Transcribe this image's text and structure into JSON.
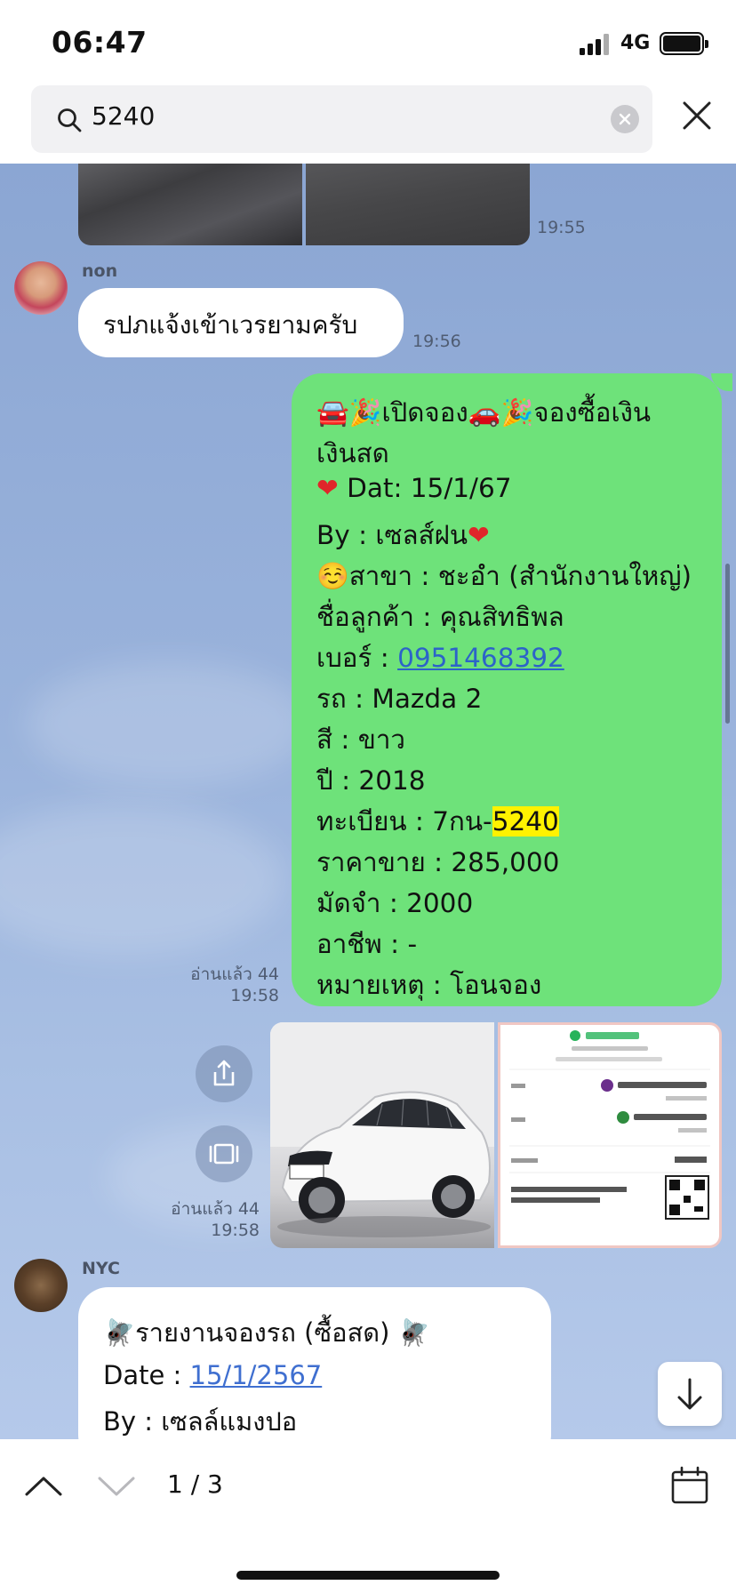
{
  "status_bar": {
    "time": "06:47",
    "network": "4G"
  },
  "search": {
    "query": "5240"
  },
  "messages": {
    "photo_time": "19:55",
    "msg1": {
      "sender": "non",
      "text": "รปภแจ้งเข้าเวรยามครับ",
      "time": "19:56"
    },
    "msg2": {
      "read": "อ่านแล้ว 44",
      "time": "19:58",
      "lines": {
        "l1": "🚘🎉เปิดจอง🚗🎉จองซื้อเงิน",
        "l2": "เงินสด",
        "l3_label": "Dat: 15/1/67",
        "l4_label": "By : เซลส์ฝน",
        "l5": "☺️สาขา : ชะอำ (สำนักงานใหญ่)",
        "l6": "ชื่อลูกค้า : คุณสิทธิพล",
        "l7_prefix": "เบอร์ : ",
        "l7_phone": "0951468392",
        "l8": "รถ : Mazda 2",
        "l9": "สี : ขาว",
        "l10": "ปี : 2018",
        "l11_prefix": "ทะเบียน : 7กน-",
        "l11_match": "5240",
        "l12": "ราคาขาย : 285,000",
        "l13": "มัดจำ : 2000",
        "l14": "อาชีพ : -",
        "l15": "หมายเหตุ : โอนจอง"
      }
    },
    "msg3": {
      "read": "อ่านแล้ว 44",
      "time": "19:58"
    },
    "msg4": {
      "sender": "NYC",
      "title": "🪰รายงานจองรถ (ซื้อสด) 🪰",
      "date_prefix": "Date : ",
      "date_link": "15/1/2567",
      "by": "By : เซลล์แมงปอ"
    }
  },
  "bottom": {
    "counter": "1 / 3"
  },
  "colors": {
    "chat_bg": "#8ba6d3",
    "sent_bubble": "#6ee27a",
    "received_bubble": "#ffffff",
    "highlight": "#fff200",
    "link": "#2c63c9"
  }
}
